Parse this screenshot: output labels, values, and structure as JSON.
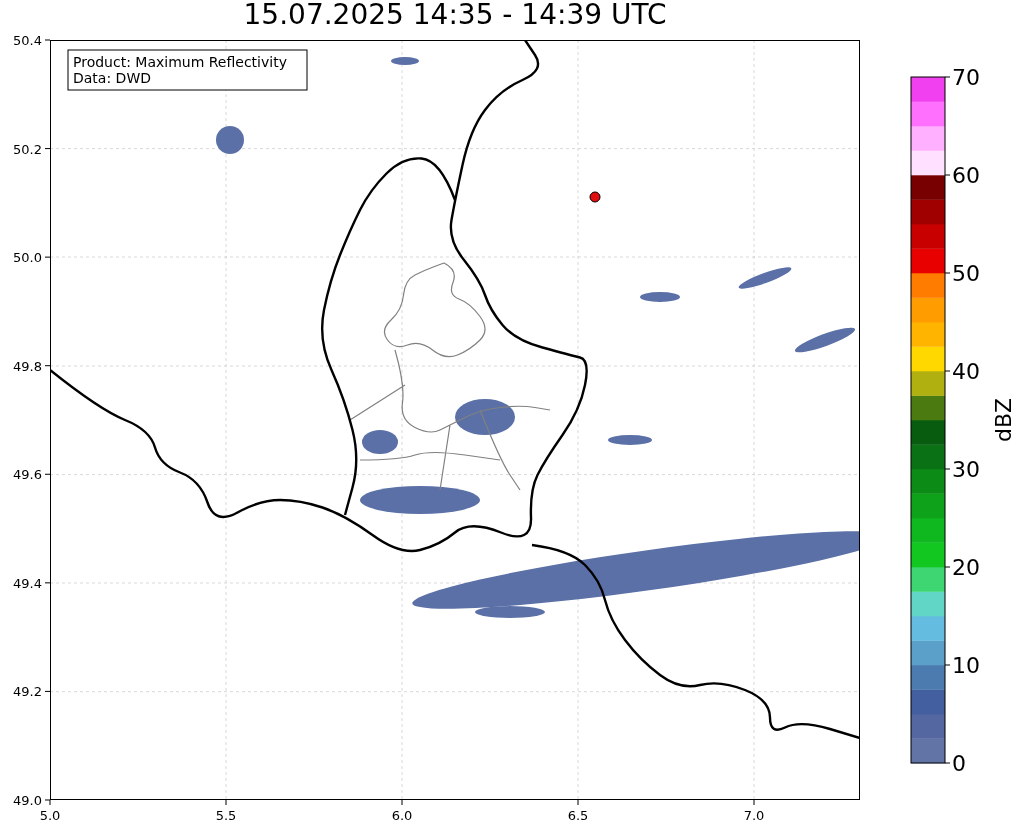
{
  "title": "15.07.2025 14:35 - 14:39 UTC",
  "info_box": {
    "lines": [
      "Product: Maximum Reflectivity",
      "Data: DWD"
    ]
  },
  "map": {
    "xticks": [
      "5.0",
      "5.5",
      "6.0",
      "6.5",
      "7.0"
    ],
    "yticks": [
      "50.4",
      "50.2",
      "50.0",
      "49.8",
      "49.6",
      "49.4",
      "49.2",
      "49.0"
    ]
  },
  "colorbar": {
    "label": "dBZ",
    "ticks": [
      "70",
      "60",
      "50",
      "40",
      "30",
      "20",
      "10",
      "0"
    ],
    "bins": [
      {
        "color": "#6274a6"
      },
      {
        "color": "#5467a0"
      },
      {
        "color": "#445fa0"
      },
      {
        "color": "#4c7bb0"
      },
      {
        "color": "#5aa0c8"
      },
      {
        "color": "#64bce0"
      },
      {
        "color": "#62d6c6"
      },
      {
        "color": "#3ed672"
      },
      {
        "color": "#12c820"
      },
      {
        "color": "#10b820"
      },
      {
        "color": "#0ea21a"
      },
      {
        "color": "#0c8c16"
      },
      {
        "color": "#0a7214"
      },
      {
        "color": "#085c10"
      },
      {
        "color": "#4a7a10"
      },
      {
        "color": "#b0b010"
      },
      {
        "color": "#ffd800"
      },
      {
        "color": "#ffb400"
      },
      {
        "color": "#ff9c00"
      },
      {
        "color": "#ff7c00"
      },
      {
        "color": "#e80000"
      },
      {
        "color": "#c80000"
      },
      {
        "color": "#a00000"
      },
      {
        "color": "#780000"
      },
      {
        "color": "#ffe0ff"
      },
      {
        "color": "#ffb0ff"
      },
      {
        "color": "#ff70ff"
      },
      {
        "color": "#f040f0"
      }
    ]
  }
}
